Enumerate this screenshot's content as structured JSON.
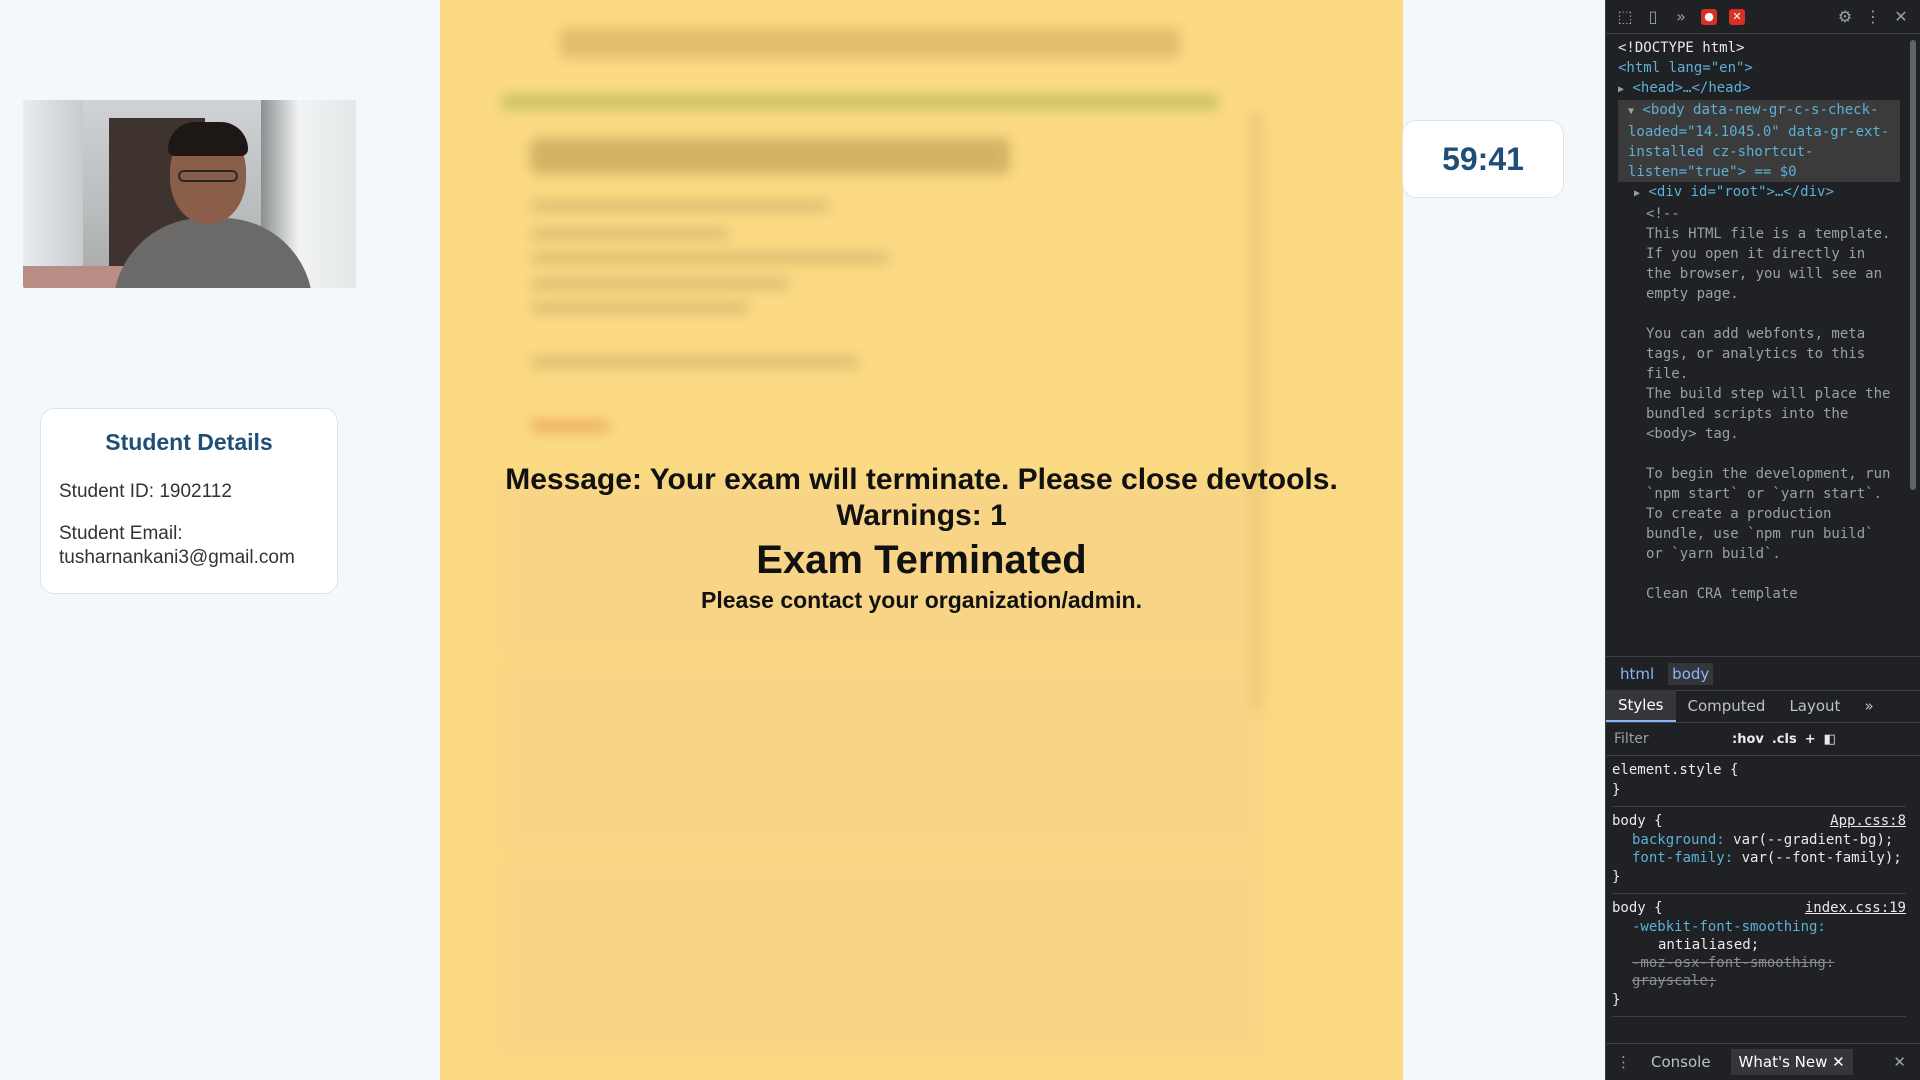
{
  "student": {
    "title": "Student Details",
    "id_line": "Student ID: 1902112",
    "email_label": "Student Email:",
    "email_value": "tusharnankani3@gmail.com"
  },
  "exam_overlay": {
    "message": "Message: Your exam will terminate. Please close devtools.",
    "warnings": "Warnings: 1",
    "status": "Exam Terminated",
    "contact": "Please contact your organization/admin."
  },
  "timer": {
    "value": "59:41"
  },
  "devtools": {
    "elements_lines": [
      "<!DOCTYPE html>",
      "<html lang=\"en\">",
      "<head>…</head>",
      "<body data-new-gr-c-s-check-loaded=\"14.1045.0\" data-gr-ext-installed cz-shortcut-listen=\"true\"> == $0",
      "<div id=\"root\">…</div>",
      "<!--"
    ],
    "comment_text": "This HTML file is a template.\nIf you open it directly in the browser, you will see an empty page.\n\nYou can add webfonts, meta tags, or analytics to this file.\nThe build step will place the bundled scripts into the <body> tag.\n\nTo begin the development, run `npm start` or `yarn start`.\nTo create a production bundle, use `npm run build` or `yarn build`.\n\nClean CRA template",
    "breadcrumbs": [
      "html",
      "body"
    ],
    "tabs": [
      "Styles",
      "Computed",
      "Layout"
    ],
    "filter_placeholder": "Filter",
    "filter_hov": ":hov",
    "filter_cls": ".cls",
    "rules": {
      "element_style": "element.style {",
      "close_brace": "}",
      "body1_selector": "body {",
      "body1_source": "App.css:8",
      "body1_prop1_name": "background:",
      "body1_prop1_val": "var(--gradient-bg);",
      "body1_prop2_name": "font-family:",
      "body1_prop2_val": "var(--font-family);",
      "body2_selector": "body {",
      "body2_source": "index.css:19",
      "body2_prop1_name": "-webkit-font-smoothing:",
      "body2_prop1_val": "antialiased;",
      "body2_prop2": "-moz-osx-font-smoothing: grayscale;"
    },
    "drawer_tabs": [
      "Console",
      "What's New"
    ]
  }
}
